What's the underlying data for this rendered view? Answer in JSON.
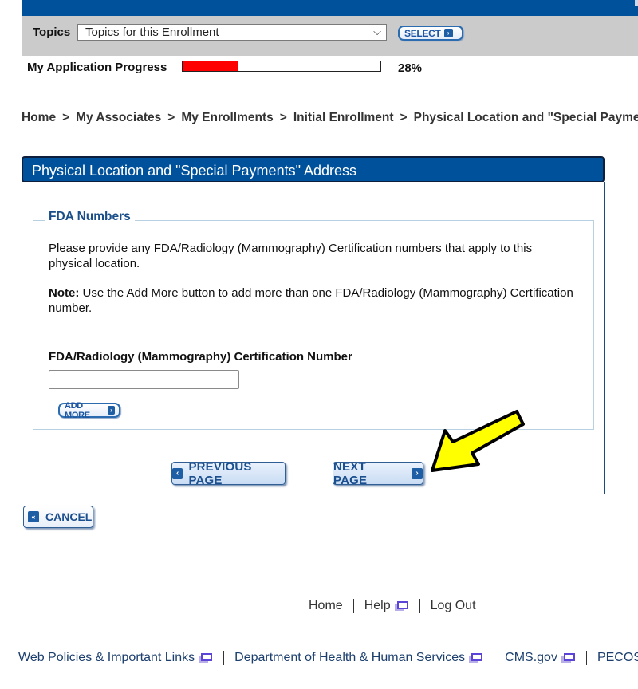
{
  "header": {
    "topics_label": "Topics",
    "topics_select_value": "Topics for this Enrollment",
    "select_button": "SELECT"
  },
  "progress": {
    "label": "My Application Progress",
    "percent": 28,
    "percent_text": "28%",
    "fill_color": "#ff0000"
  },
  "breadcrumb": [
    "Home",
    "My Associates",
    "My Enrollments",
    "Initial Enrollment",
    "Physical Location and \"Special Payments\" Address"
  ],
  "breadcrumb_separator": ">",
  "panel": {
    "title": "Physical Location and \"Special Payments\" Address",
    "section_legend": "FDA Numbers",
    "instruction": "Please provide any FDA/Radiology (Mammography) Certification numbers that apply to this physical location.",
    "note_label": "Note:",
    "note_text": " Use the Add More button to add more than one FDA/Radiology (Mammography) Certification number.",
    "field_label": "FDA/Radiology (Mammography) Certification Number",
    "field_value": "",
    "add_more_button": "ADD MORE"
  },
  "navigation": {
    "previous_button": "PREVIOUS PAGE",
    "next_button": "NEXT PAGE",
    "cancel_button": "CANCEL"
  },
  "footer_links": {
    "home": "Home",
    "help": "Help",
    "logout": "Log Out"
  },
  "bottom_links": {
    "web_policies": "Web Policies & Important Links",
    "hhs": "Department of Health & Human Services",
    "cms": "CMS.gov",
    "pecos": "PECOS"
  },
  "colors": {
    "brand_blue": "#00519c",
    "annotation_arrow": "#ffff00"
  }
}
